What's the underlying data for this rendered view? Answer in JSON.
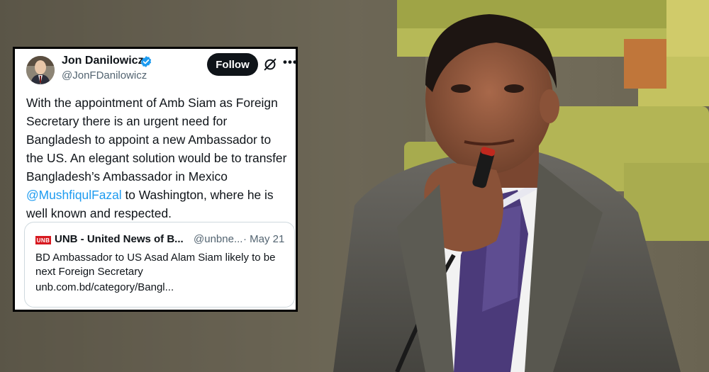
{
  "tweet": {
    "author_name": "Jon Danilowicz",
    "handle": "@JonFDanilowicz",
    "follow_label": "Follow",
    "more_label": "•••",
    "body_before": "With the appointment of Amb Siam as Foreign Secretary there is an urgent need for Bangladesh to appoint a new Ambassador to the US.   An elegant solution would be to transfer Bangladesh’s Ambassador in Mexico ",
    "mention": "@MushfiqulFazal",
    "body_after": " to Washington, where he is well known and respected.",
    "quote": {
      "logo_text": "UNB",
      "source_name": "UNB - United News of B...",
      "handle": "@unbne...",
      "date": "· May 21",
      "text": "BD Ambassador to US Asad Alam Siam likely to be next Foreign Secretary",
      "link": "unb.com.bd/category/Bangl..."
    }
  },
  "colors": {
    "link_blue": "#1d9bf0",
    "verified_blue": "#1d9bf0",
    "unb_red": "#d71920",
    "text_dark": "#0f1419",
    "text_gray": "#536471"
  }
}
